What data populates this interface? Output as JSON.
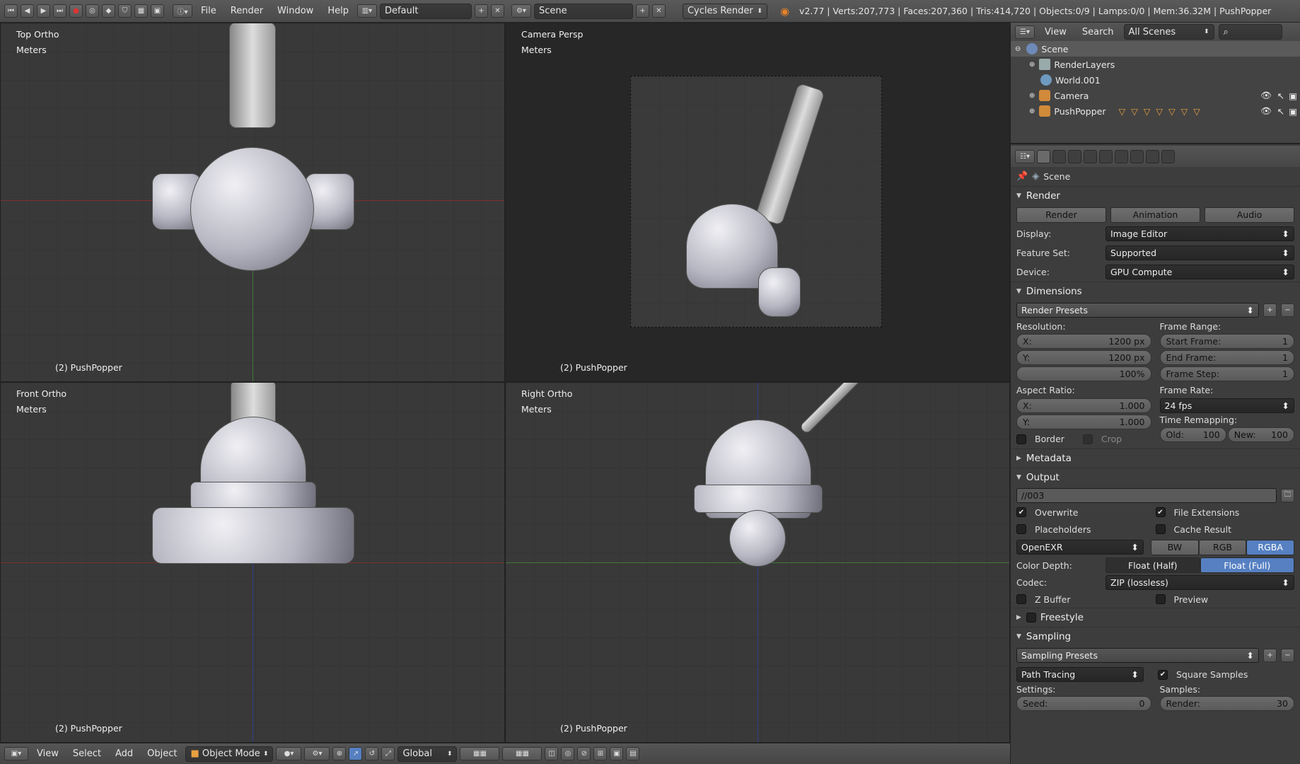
{
  "topbar": {
    "menus": [
      "File",
      "Render",
      "Window",
      "Help"
    ],
    "screen_layout": "Default",
    "scene": "Scene",
    "engine": "Cycles Render",
    "stats": "v2.77 | Verts:207,773 | Faces:207,360 | Tris:414,720 | Objects:0/9 | Lamps:0/0 | Mem:36.32M | PushPopper"
  },
  "viewports": [
    {
      "view": "Top Ortho",
      "units": "Meters",
      "object": "(2) PushPopper"
    },
    {
      "view": "Camera Persp",
      "units": "Meters",
      "object": "(2) PushPopper"
    },
    {
      "view": "Front Ortho",
      "units": "Meters",
      "object": "(2) PushPopper"
    },
    {
      "view": "Right Ortho",
      "units": "Meters",
      "object": "(2) PushPopper"
    }
  ],
  "bottombar": {
    "menus": [
      "View",
      "Select",
      "Add",
      "Object"
    ],
    "mode": "Object Mode",
    "orientation": "Global"
  },
  "outliner": {
    "menus": [
      "View",
      "Search"
    ],
    "filter": "All Scenes",
    "items": [
      "Scene",
      "RenderLayers",
      "World.001",
      "Camera",
      "PushPopper"
    ]
  },
  "properties": {
    "context": "Scene",
    "render": {
      "title": "Render",
      "buttons": [
        "Render",
        "Animation",
        "Audio"
      ],
      "display_label": "Display:",
      "display": "Image Editor",
      "feature_set_label": "Feature Set:",
      "feature_set": "Supported",
      "device_label": "Device:",
      "device": "GPU Compute"
    },
    "dimensions": {
      "title": "Dimensions",
      "presets": "Render Presets",
      "resolution_label": "Resolution:",
      "res_x_label": "X:",
      "res_x": "1200 px",
      "res_y_label": "Y:",
      "res_y": "1200 px",
      "res_pct": "100%",
      "frame_range_label": "Frame Range:",
      "start_label": "Start Frame:",
      "start": "1",
      "end_label": "End Frame:",
      "end": "1",
      "step_label": "Frame Step:",
      "step": "1",
      "aspect_label": "Aspect Ratio:",
      "asp_x_label": "X:",
      "asp_x": "1.000",
      "asp_y_label": "Y:",
      "asp_y": "1.000",
      "frame_rate_label": "Frame Rate:",
      "frame_rate": "24 fps",
      "time_remap_label": "Time Remapping:",
      "old_label": "Old:",
      "old": "100",
      "new_label": "New:",
      "new": "100",
      "border": "Border",
      "crop": "Crop"
    },
    "metadata": {
      "title": "Metadata"
    },
    "output": {
      "title": "Output",
      "path": "//003",
      "overwrite": "Overwrite",
      "file_ext": "File Extensions",
      "placeholders": "Placeholders",
      "cache": "Cache Result",
      "format": "OpenEXR",
      "color_modes": [
        "BW",
        "RGB",
        "RGBA"
      ],
      "color_depth_label": "Color Depth:",
      "depths": [
        "Float (Half)",
        "Float (Full)"
      ],
      "codec_label": "Codec:",
      "codec": "ZIP (lossless)",
      "zbuffer": "Z Buffer",
      "preview": "Preview"
    },
    "freestyle": {
      "title": "Freestyle"
    },
    "sampling": {
      "title": "Sampling",
      "presets": "Sampling Presets",
      "integrator": "Path Tracing",
      "square": "Square Samples",
      "settings_label": "Settings:",
      "samples_label": "Samples:",
      "seed_label": "Seed:",
      "seed": "0",
      "render_label": "Render:",
      "render": "30"
    }
  }
}
